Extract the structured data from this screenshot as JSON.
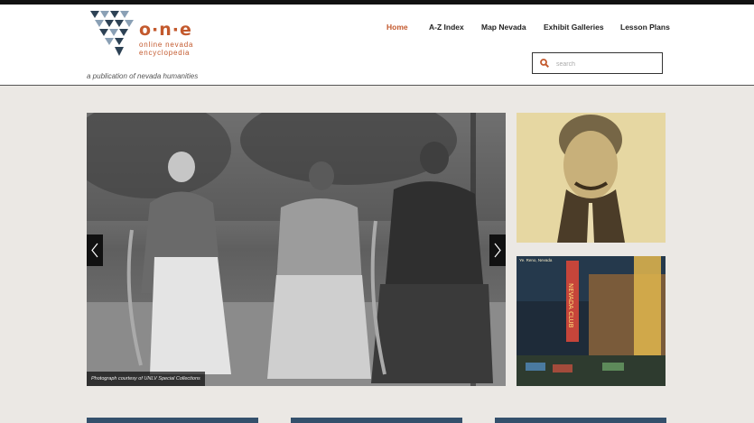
{
  "brand": {
    "letters": "o·n·e",
    "sub_line1": "online nevada",
    "sub_line2": "encyclopedia",
    "tagline": "a publication of nevada humanities"
  },
  "nav": {
    "items": [
      {
        "label": "Home",
        "active": true
      },
      {
        "label": "A-Z Index",
        "active": false
      },
      {
        "label": "Map Nevada",
        "active": false
      },
      {
        "label": "Exhibit Galleries",
        "active": false
      },
      {
        "label": "Lesson Plans",
        "active": false
      }
    ]
  },
  "search": {
    "placeholder": "search",
    "value": ""
  },
  "slider": {
    "caption": "Photograph courtesy of UNLV Special Collections"
  },
  "side_images": {
    "second_label": "Ye. Reno, Nevada",
    "second_sign_text": "NEVADA CLUB"
  },
  "colors": {
    "accent": "#c3592d",
    "logo_dark": "#2d4255",
    "logo_light": "#8aa0b5",
    "footer_bar": "#34506c",
    "page_bg": "#ebe8e4"
  },
  "icons": [
    "logo-triangles",
    "search-icon",
    "chevron-left-icon",
    "chevron-right-icon"
  ]
}
